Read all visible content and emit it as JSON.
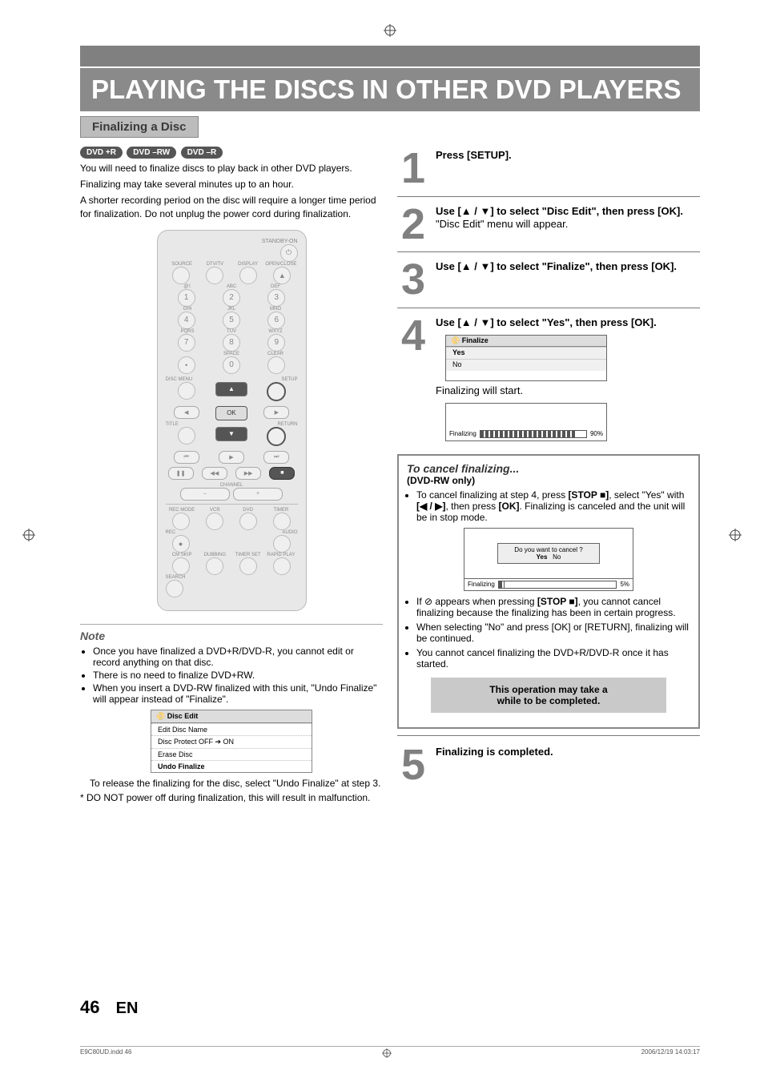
{
  "meta": {
    "domain": "Document"
  },
  "header": {
    "title": "PLAYING THE DISCS IN OTHER DVD PLAYERS",
    "section": "Finalizing a Disc"
  },
  "disc_badges": [
    "DVD +R",
    "DVD –RW",
    "DVD –R"
  ],
  "intro": {
    "p1": "You will need to finalize discs to play back in other DVD players.",
    "p2": "Finalizing may take several minutes up to an hour.",
    "p3": "A shorter recording period on the disc will require a longer time period for finalization. Do not unplug the power cord during finalization."
  },
  "remote": {
    "standby": "STANDBY-ON",
    "labels_row1": [
      "SOURCE",
      "DTV/TV",
      "DISPLAY",
      "OPEN/CLOSE"
    ],
    "labels_keys1": "@!:",
    "labels_keys2": "ABC",
    "labels_keys3": "DEF",
    "labels_keys4": "GHI",
    "labels_keys5": "JKL",
    "labels_keys6": "MNO",
    "labels_keys7": "PQRS",
    "labels_keys8": "TUV",
    "labels_keys9": "WXYZ",
    "labels_keys10": "SPACE",
    "labels_keys11": "CLEAR",
    "disc_menu": "DISC MENU",
    "setup": "SETUP",
    "ok": "OK",
    "title": "TITLE",
    "ret": "RETURN",
    "channel": "CHANNEL",
    "rec_mode": "REC MODE",
    "vcr": "VCR",
    "dvd": "DVD",
    "timer": "TIMER",
    "rec": "REC",
    "audio": "AUDIO",
    "cmskip": "CM SKIP",
    "dubbing": "DUBBING",
    "timer_set": "TIMER SET",
    "rapid": "RAPID PLAY",
    "search": "SEARCH"
  },
  "note": {
    "heading": "Note",
    "items": [
      "Once you have finalized a DVD+R/DVD-R, you cannot edit or record anything on that disc.",
      "There is no need to finalize DVD+RW.",
      "When you insert a DVD-RW finalized with this unit, \"Undo Finalize\" will appear instead of  \"Finalize\"."
    ],
    "menu": {
      "title": "Disc Edit",
      "items": [
        "Edit Disc Name",
        "Disc Protect OFF ➔ ON",
        "Erase Disc",
        "Undo Finalize"
      ]
    },
    "after_menu": "To release the finalizing for the disc, select \"Undo Finalize\" at step 3.",
    "asterisk": "* DO NOT power off during finalization, this will result in malfunction."
  },
  "steps": {
    "s1": {
      "n": "1",
      "text": "Press [SETUP]."
    },
    "s2": {
      "n": "2",
      "l1": "Use [▲ / ▼] to select \"Disc Edit\", then press [OK].",
      "l2": "\"Disc Edit\" menu will appear."
    },
    "s3": {
      "n": "3",
      "text": "Use [▲ / ▼] to select \"Finalize\", then press [OK]."
    },
    "s4": {
      "n": "4",
      "l1": "Use [▲ / ▼] to select \"Yes\", then press [OK].",
      "menu_title": "Finalize",
      "opt_yes": "Yes",
      "opt_no": "No",
      "l2": "Finalizing will start.",
      "progress_label": "Finalizing",
      "progress_pct": "90%",
      "progress_fill_pct": 90
    },
    "s5": {
      "n": "5",
      "text": "Finalizing is completed."
    }
  },
  "cancel": {
    "title": "To cancel finalizing...",
    "sub": "(DVD-RW only)",
    "b1_a": "To cancel finalizing at step 4, press ",
    "b1_b": "[STOP ■]",
    "b1_c": ", select \"Yes\" with ",
    "b1_d": "[◀ / ▶]",
    "b1_e": ", then press ",
    "b1_f": "[OK]",
    "b1_g": ". Finalizing is canceled and the unit will be in stop mode.",
    "dialog": {
      "q": "Do you want to cancel ?",
      "yes": "Yes",
      "no": "No",
      "label": "Finalizing",
      "pct": "5%",
      "fill_pct": 5
    },
    "b2_a": "If ",
    "b2_symbol": "⊘",
    "b2_b": " appears when pressing ",
    "b2_c": "[STOP ■]",
    "b2_d": ", you cannot cancel finalizing because the finalizing has been in certain progress.",
    "b3": "When selecting \"No\" and press [OK] or [RETURN], finalizing will be continued.",
    "b4": "You cannot cancel finalizing the DVD+R/DVD-R once it has started.",
    "warn_l1": "This operation may take a",
    "warn_l2": "while to be completed."
  },
  "footer": {
    "page": "46",
    "lang": "EN",
    "indd": "E9C80UD.indd   46",
    "date": "2006/12/19   14:03:17"
  }
}
